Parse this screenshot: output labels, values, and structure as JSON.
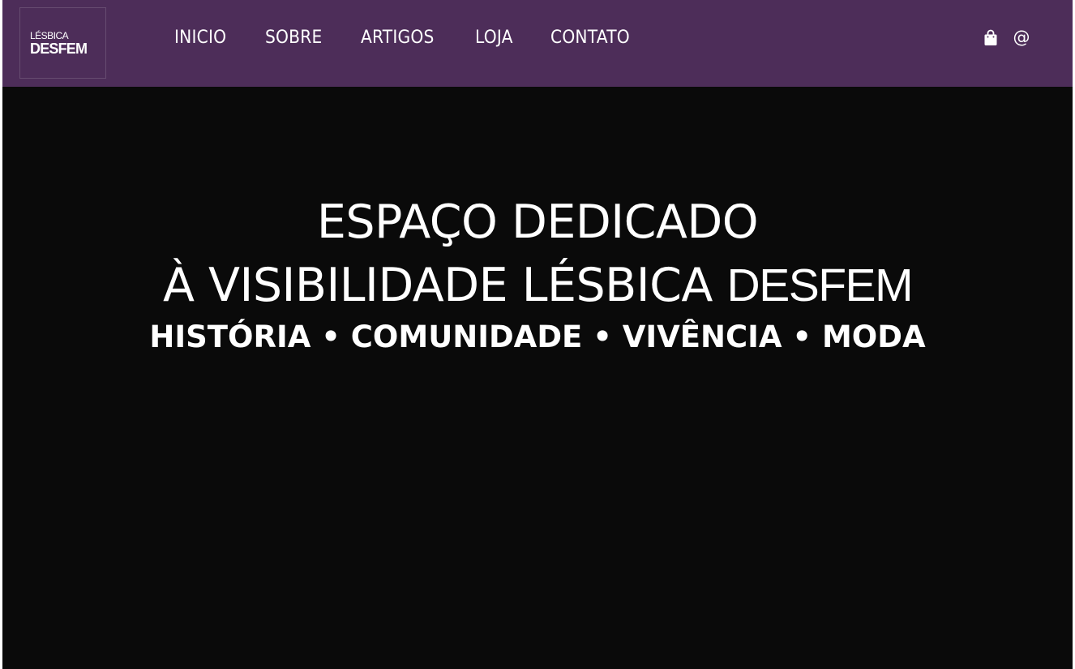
{
  "brand": {
    "logo_top": "LÉSBICA",
    "logo_bottom": "DESFEM"
  },
  "nav": {
    "items": [
      {
        "label": "INICIO"
      },
      {
        "label": "SOBRE"
      },
      {
        "label": "ARTIGOS"
      },
      {
        "label": "LOJA"
      },
      {
        "label": "CONTATO"
      }
    ],
    "icons": {
      "cart": "shopping-bag-icon",
      "contact": "at-sign-icon",
      "contact_glyph": "@"
    }
  },
  "hero": {
    "headline_line1": "ESPAÇO DEDICADO",
    "headline_line2": "À VISIBILIDADE LÉSBICA",
    "headline_brand": "DESFEM",
    "tagline": "HISTÓRIA • COMUNIDADE • VIVÊNCIA • MODA"
  },
  "colors": {
    "navbar_bg": "#4d2d59",
    "hero_bg": "#0a0a0a",
    "text": "#ffffff"
  }
}
